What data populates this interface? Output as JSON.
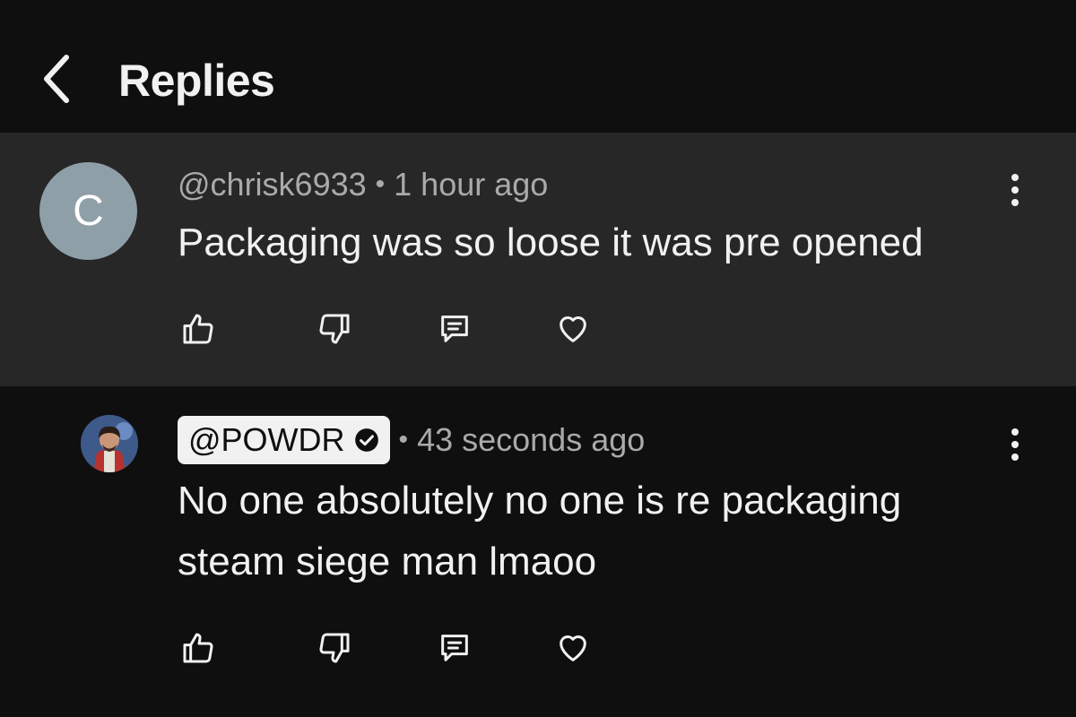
{
  "header": {
    "title": "Replies",
    "back_icon": "chevron-left-icon"
  },
  "parent_comment": {
    "avatar_letter": "C",
    "avatar_color": "#8f9fa8",
    "handle": "@chrisk6933",
    "separator": "•",
    "time": "1 hour ago",
    "text": "Packaging was so loose it was pre opened",
    "background": "#272727"
  },
  "reply_comment": {
    "handle": "@POWDR",
    "verified": true,
    "separator": "•",
    "time": "43 seconds ago",
    "text_line1": "No one absolutely no one is re packaging",
    "text_line2": "steam siege man lmaoo"
  },
  "actions": [
    "thumbs-up-icon",
    "thumbs-down-icon",
    "reply-icon",
    "heart-icon"
  ],
  "colors": {
    "background": "#0f0f0f",
    "text_primary": "#f1f1f1",
    "text_secondary": "#aaaaaa"
  }
}
